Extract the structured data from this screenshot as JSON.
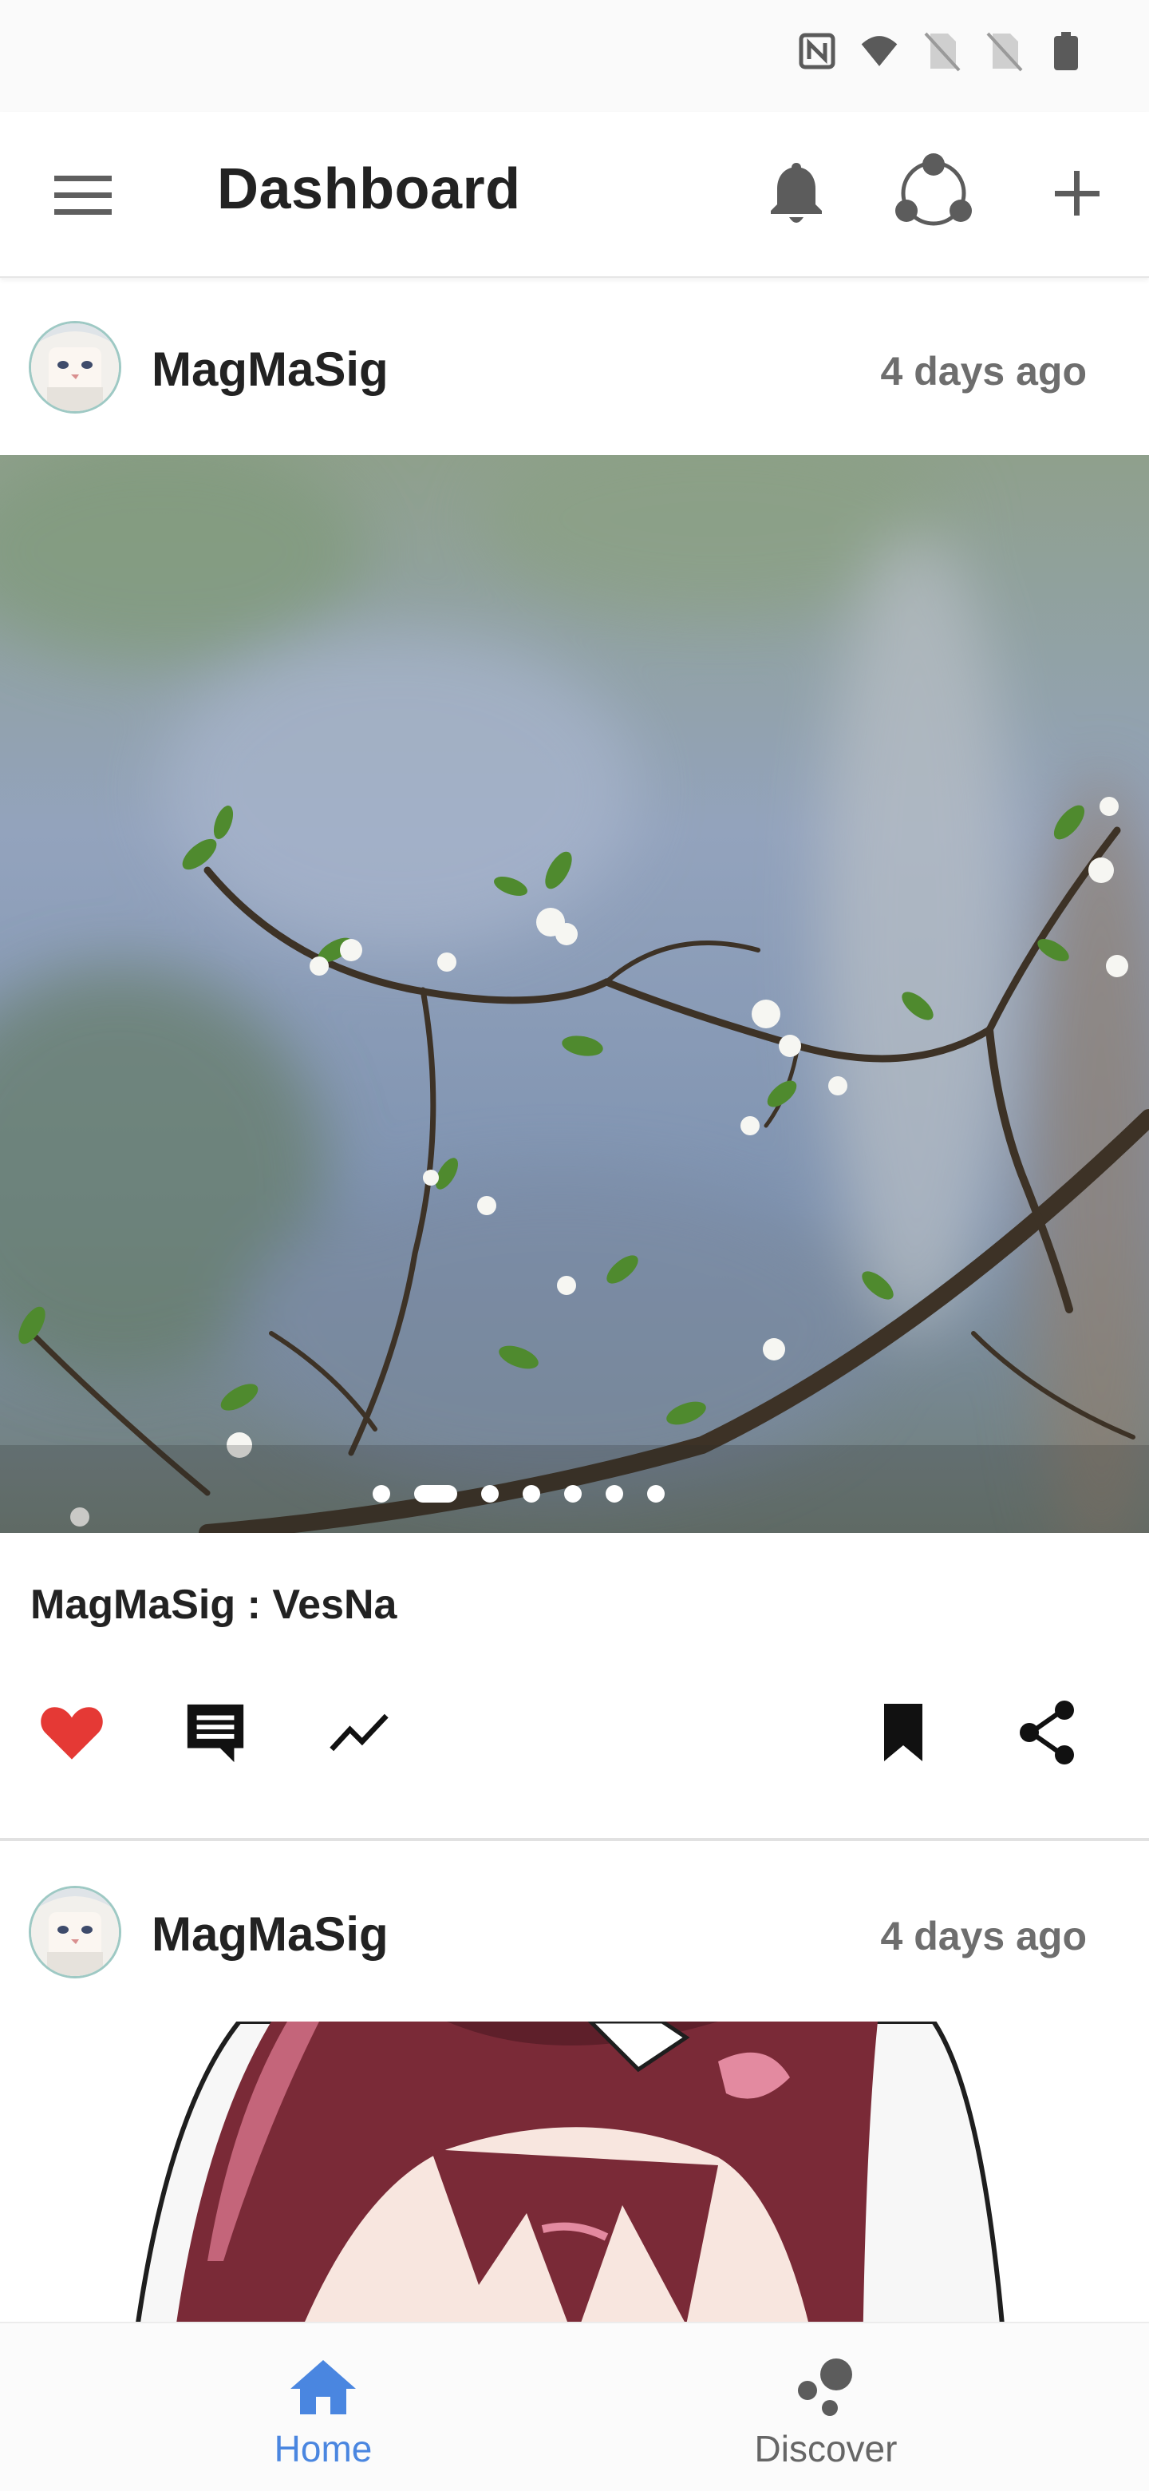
{
  "app_bar": {
    "title": "Dashboard",
    "icons": [
      "hamburger-menu-icon",
      "bell-icon",
      "group-icon",
      "plus-icon"
    ]
  },
  "status_bar": {
    "icons": [
      "nfc-icon",
      "wifi-icon",
      "no-sim-icon",
      "no-sim-icon",
      "battery-icon"
    ]
  },
  "posts": [
    {
      "author": "MagMaSig",
      "time": "4 days ago",
      "caption": "MagMaSig : VesNa",
      "image_count": 7,
      "active_image": 2,
      "liked": true
    },
    {
      "author": "MagMaSig",
      "time": "4 days ago"
    }
  ],
  "actions": {
    "icons": [
      "heart-icon",
      "comment-icon",
      "trending-icon",
      "bookmark-icon",
      "share-icon"
    ],
    "like_color": "#e53935"
  },
  "bottom_nav": {
    "items": [
      {
        "label": "Home",
        "icon": "home-icon",
        "active": true
      },
      {
        "label": "Discover",
        "icon": "discover-icon",
        "active": false
      }
    ],
    "active_color": "#4a86e0"
  }
}
